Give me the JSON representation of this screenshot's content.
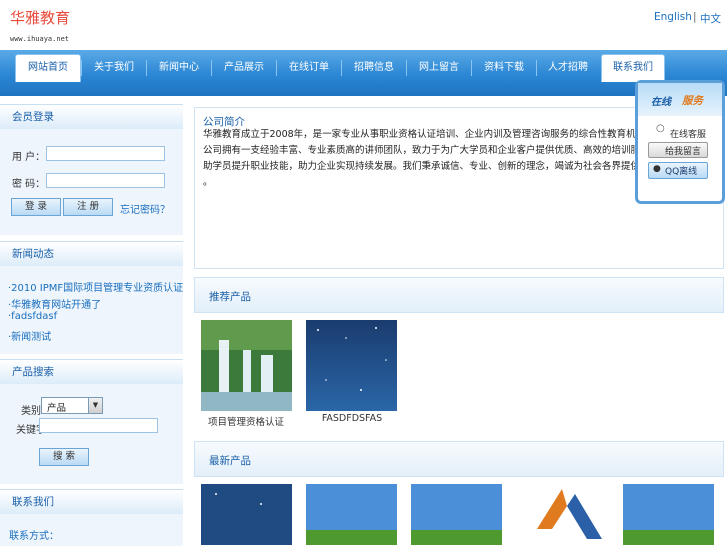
{
  "header": {
    "logo_text": "华雅教育",
    "logo_url": "www.ihuaya.net",
    "lang_en": "English",
    "lang_sep": "|",
    "lang_cn": "中文"
  },
  "nav": {
    "items": [
      {
        "label": "网站首页"
      },
      {
        "label": "关于我们"
      },
      {
        "label": "新闻中心"
      },
      {
        "label": "产品展示"
      },
      {
        "label": "在线订单"
      },
      {
        "label": "招聘信息"
      },
      {
        "label": "网上留言"
      },
      {
        "label": "资料下载"
      },
      {
        "label": "人才招聘"
      },
      {
        "label": "联系我们"
      }
    ]
  },
  "sidebar": {
    "login": {
      "title": "会员登录",
      "user_label": "用 户：",
      "pass_label": "密 码：",
      "login_btn": "登 录",
      "reg_btn": "注 册",
      "forgot": "忘记密码？"
    },
    "news": {
      "title": "新闻动态",
      "items": [
        "·2010 IPMF国际项目管理专业资质认证",
        "·华雅教育网站开通了",
        "·fadsfdasf",
        "·新闻测试"
      ]
    },
    "search": {
      "title": "产品搜索",
      "type_label": "类别：",
      "type_value": "产品",
      "keyword_label": "关键字：",
      "search_btn": "搜 索"
    },
    "contact": {
      "title": "联系我们",
      "item": "联系方式："
    }
  },
  "main": {
    "intro": {
      "title": "公司简介",
      "lines": [
        "华雅教育成立于2008年，是一家专业从事职业资格认证培训、企业内训及管理咨询服务的综合性教育机构。",
        "公司拥有一支经验丰富、专业素质高的讲师团队，致力于为广大学员和企业客户提供优质、高效的培训服务，帮",
        "助学员提升职业技能，助力企业实现持续发展。我们秉承诚信、专业、创新的理念，竭诚为社会各界提供服务",
        "。"
      ]
    },
    "recommend": {
      "title": "推荐产品",
      "items": [
        {
          "caption": "项目管理资格认证"
        },
        {
          "caption": "FASDFDSFAS"
        }
      ]
    },
    "latest": {
      "title": "最新产品"
    }
  },
  "qq_panel": {
    "title_a": "在线",
    "title_b": "服务",
    "contact": "在线客服",
    "leave_msg": "给我留言",
    "qq": "QQ离线"
  },
  "colors": {
    "brand_red": "#e84c3d",
    "nav_blue": "#2b86d4",
    "link_blue": "#1a6fbf",
    "sidebar_bg": "#eef5fc"
  }
}
